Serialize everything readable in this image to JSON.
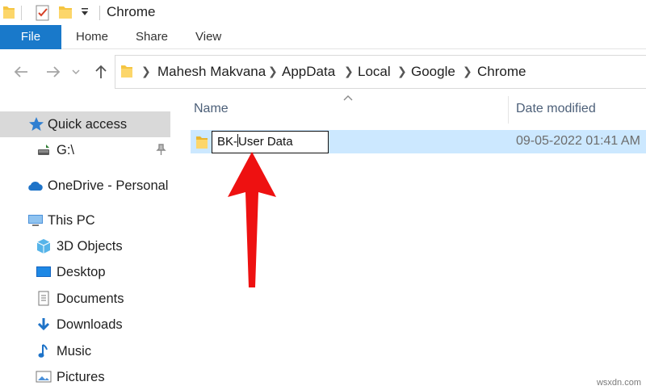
{
  "window": {
    "title": "Chrome"
  },
  "ribbon": {
    "tabs": [
      {
        "label": "File"
      },
      {
        "label": "Home"
      },
      {
        "label": "Share"
      },
      {
        "label": "View"
      }
    ]
  },
  "address": {
    "crumbs": [
      "Mahesh Makvana",
      "AppData",
      "Local",
      "Google",
      "Chrome"
    ]
  },
  "nav": {
    "items": [
      {
        "label": "Quick access",
        "icon": "star-icon"
      },
      {
        "label": "G:\\",
        "icon": "drive-icon"
      },
      {
        "label": "OneDrive - Personal",
        "icon": "cloud-icon"
      },
      {
        "label": "This PC",
        "icon": "computer-icon"
      },
      {
        "label": "3D Objects",
        "icon": "cube-icon"
      },
      {
        "label": "Desktop",
        "icon": "desktop-icon"
      },
      {
        "label": "Documents",
        "icon": "document-icon"
      },
      {
        "label": "Downloads",
        "icon": "download-icon"
      },
      {
        "label": "Music",
        "icon": "music-icon"
      },
      {
        "label": "Pictures",
        "icon": "pictures-icon"
      }
    ]
  },
  "list": {
    "columns": {
      "name": "Name",
      "date": "Date modified"
    },
    "rows": [
      {
        "rename_prefix": "BK-",
        "rename_rest": "User Data",
        "date": "09-05-2022 01:41 AM"
      }
    ]
  },
  "colors": {
    "file_tab": "#1979ca",
    "selection": "#cce8ff",
    "annotation_arrow": "#ee1111"
  },
  "watermark": "wsxdn.com"
}
